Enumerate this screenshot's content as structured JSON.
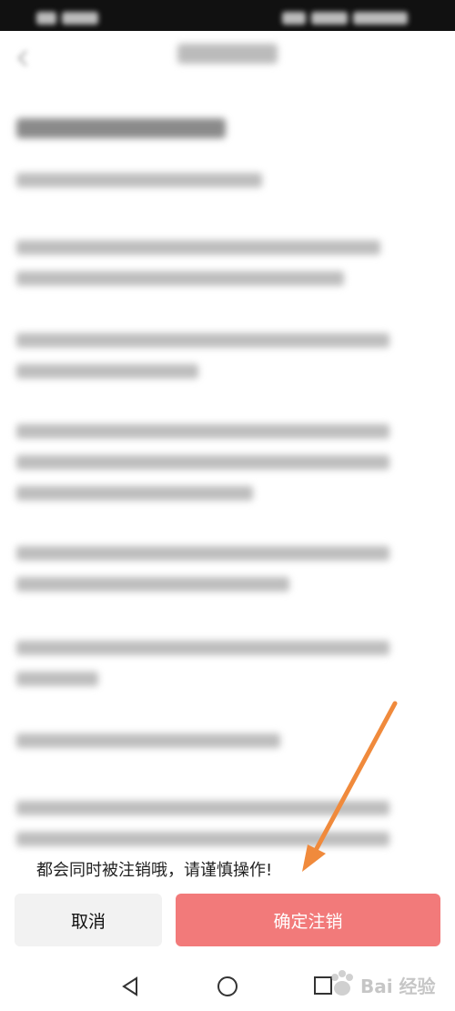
{
  "content": {
    "final_line": "都会同时被注销哦，请谨慎操作!"
  },
  "actions": {
    "cancel_label": "取消",
    "confirm_label": "确定注销"
  },
  "watermark": {
    "text": "Bai 经验"
  },
  "colors": {
    "confirm_bg": "#f27a7a",
    "cancel_bg": "#f2f2f2",
    "arrow": "#f08a3c"
  },
  "icons": [
    "back-icon",
    "nav-back-icon",
    "nav-home-icon",
    "nav-recents-icon",
    "baidu-paw-icon"
  ]
}
